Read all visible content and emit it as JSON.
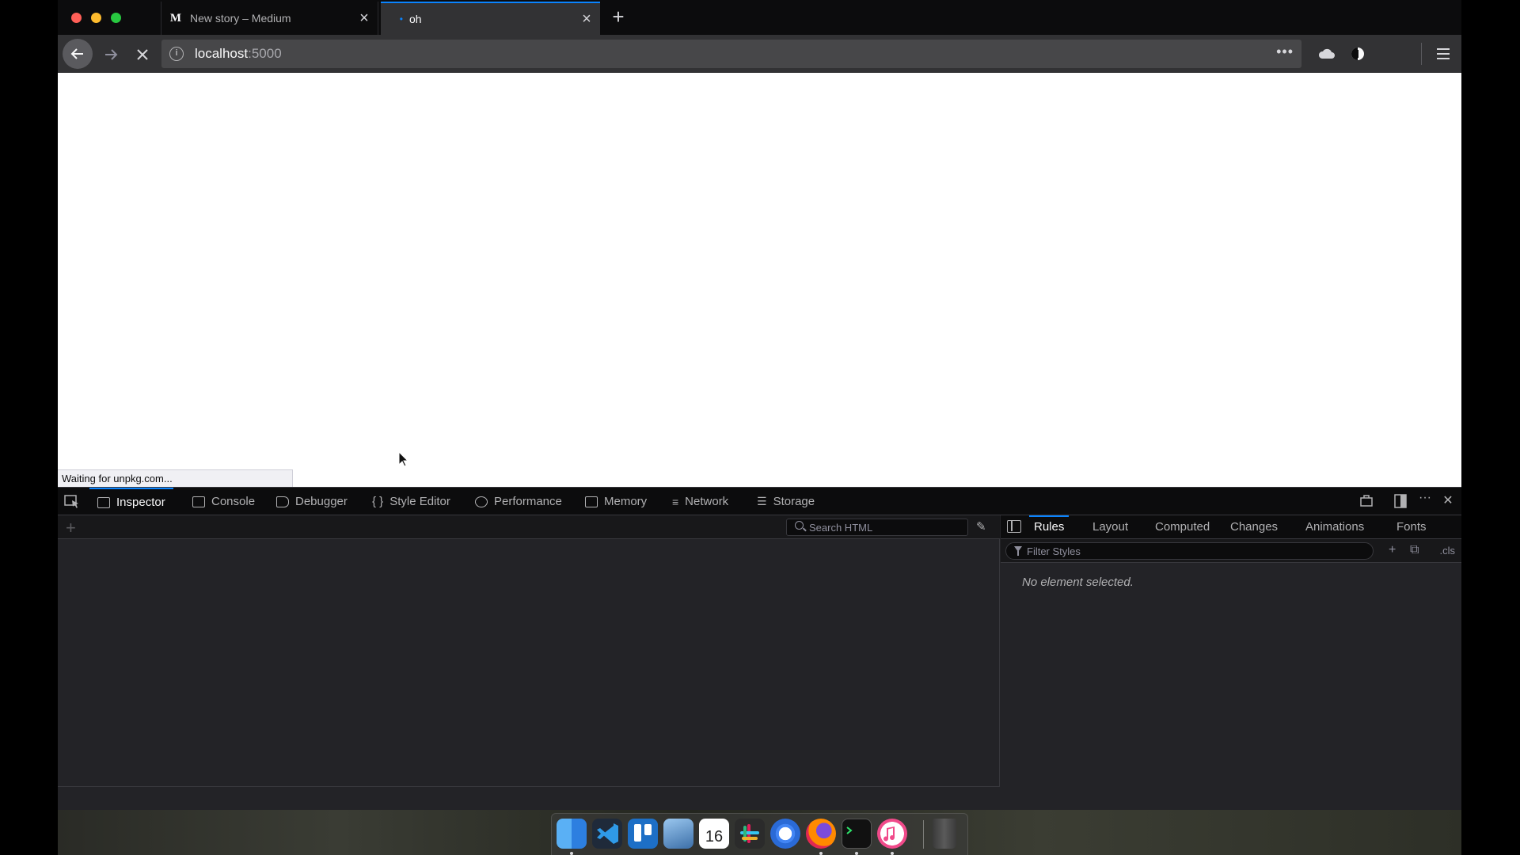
{
  "browser": {
    "tabs": [
      {
        "favicon": "M",
        "title": "New story – Medium",
        "close": "×"
      },
      {
        "favicon": "•",
        "title": "oh",
        "close": "×"
      }
    ],
    "new_tab": "+",
    "url": {
      "host": "localhost",
      "port": ":5000"
    },
    "url_more": "•••",
    "status_text": "Waiting for unpkg.com..."
  },
  "devtools": {
    "tabs": [
      {
        "label": "Inspector"
      },
      {
        "label": "Console"
      },
      {
        "label": "Debugger"
      },
      {
        "label": "Style Editor"
      },
      {
        "label": "Performance"
      },
      {
        "label": "Memory"
      },
      {
        "label": "Network"
      },
      {
        "label": "Storage"
      }
    ],
    "search_placeholder": "Search HTML",
    "sidebar_tabs": [
      {
        "label": "Rules"
      },
      {
        "label": "Layout"
      },
      {
        "label": "Computed"
      },
      {
        "label": "Changes"
      },
      {
        "label": "Animations"
      },
      {
        "label": "Fonts"
      }
    ],
    "filter_placeholder": "Filter Styles",
    "cls_label": ".cls",
    "empty_message": "No element selected."
  },
  "dock": {
    "calendar_day": "16",
    "apps": [
      "finder-icon",
      "vscode-icon",
      "trello-icon",
      "xcode-icon",
      "calendar-icon",
      "slack-icon",
      "chrome-icon",
      "firefox-icon",
      "terminal-icon",
      "itunes-icon",
      "trash-icon"
    ]
  },
  "colors": {
    "accent": "#0a84ff",
    "close_red": "#ff5f57",
    "minimize_yellow": "#febc2e",
    "zoom_green": "#28c840"
  }
}
